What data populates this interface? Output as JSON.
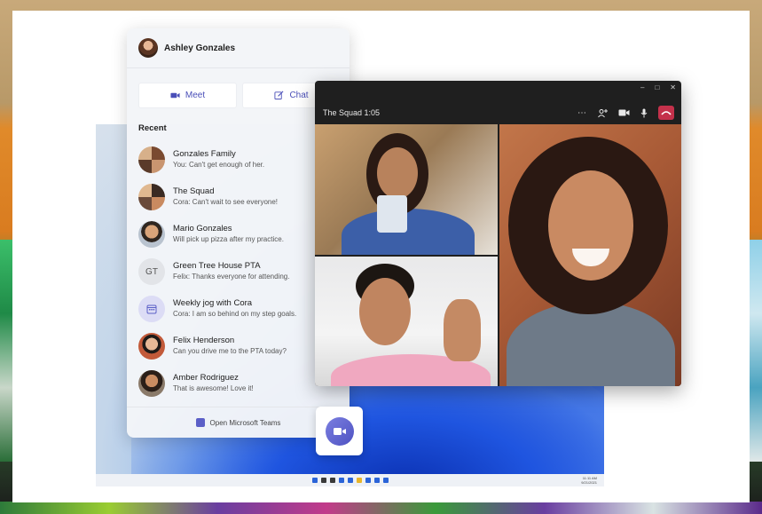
{
  "flyout": {
    "user_name": "Ashley Gonzales",
    "meet_label": "Meet",
    "chat_label": "Chat",
    "recent_label": "Recent",
    "items": [
      {
        "name": "Gonzales Family",
        "message": "You: Can't get enough of her.",
        "avatar": "group-photo"
      },
      {
        "name": "The Squad",
        "message": "Cora: Can't wait to see everyone!",
        "avatar": "group-photo"
      },
      {
        "name": "Mario Gonzales",
        "message": "Will pick up pizza after my practice.",
        "avatar": "photo"
      },
      {
        "name": "Green Tree House PTA",
        "message": "Felix: Thanks everyone for attending.",
        "avatar": "initials",
        "initials": "GT"
      },
      {
        "name": "Weekly jog with Cora",
        "message": "Cora: I am so behind on my step goals.",
        "avatar": "calendar-icon"
      },
      {
        "name": "Felix Henderson",
        "message": "Can you drive me to the PTA today?",
        "avatar": "photo"
      },
      {
        "name": "Amber Rodriguez",
        "message": "That is awesome! Love it!",
        "avatar": "photo"
      }
    ],
    "footer_label": "Open Microsoft Teams"
  },
  "call": {
    "title": "The Squad 1:05",
    "tools": [
      "more-icon",
      "participants-icon",
      "camera-icon",
      "mic-icon",
      "hangup-icon"
    ]
  },
  "taskbar": {
    "clock_line1": "11:11 AM",
    "clock_line2": "9/21/2021"
  },
  "colors": {
    "accent": "#5b5fc7",
    "hangup": "#c4314b",
    "call_bg": "#1f1f1f"
  }
}
